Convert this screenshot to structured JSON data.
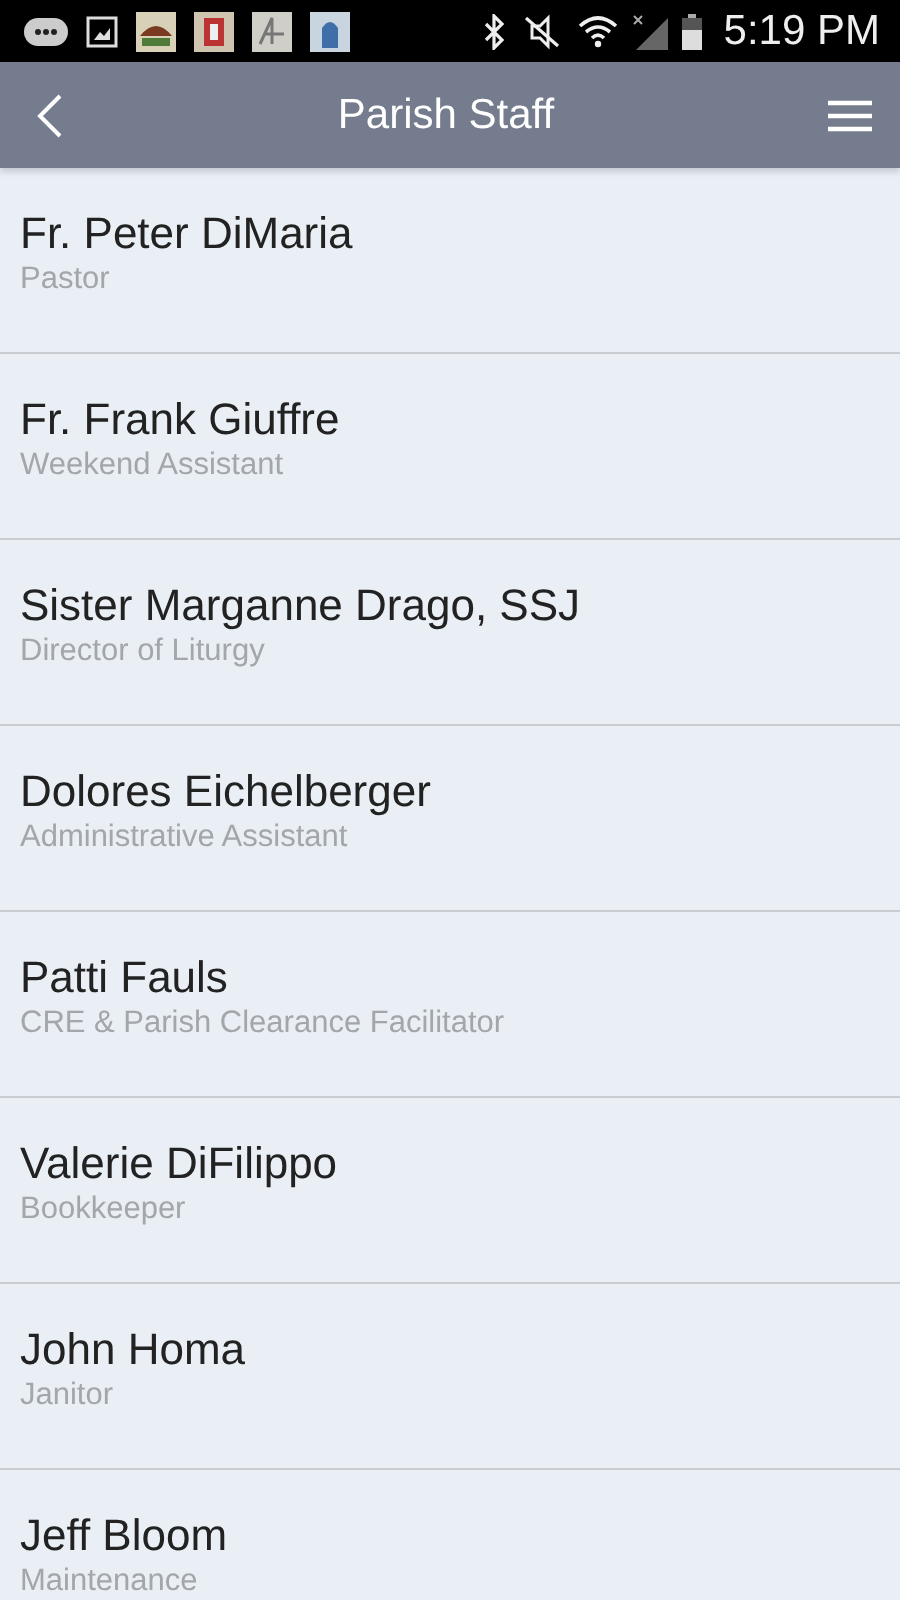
{
  "status_bar": {
    "time": "5:19 PM"
  },
  "header": {
    "title": "Parish Staff"
  },
  "staff": [
    {
      "name": "Fr. Peter DiMaria",
      "role": "Pastor"
    },
    {
      "name": "Fr. Frank Giuffre",
      "role": "Weekend Assistant"
    },
    {
      "name": "Sister Marganne Drago, SSJ",
      "role": "Director of Liturgy"
    },
    {
      "name": "Dolores Eichelberger",
      "role": "Administrative Assistant"
    },
    {
      "name": "Patti Fauls",
      "role": "CRE & Parish Clearance Facilitator"
    },
    {
      "name": "Valerie DiFilippo",
      "role": "Bookkeeper"
    },
    {
      "name": "John Homa",
      "role": "Janitor"
    },
    {
      "name": "Jeff Bloom",
      "role": "Maintenance"
    }
  ]
}
